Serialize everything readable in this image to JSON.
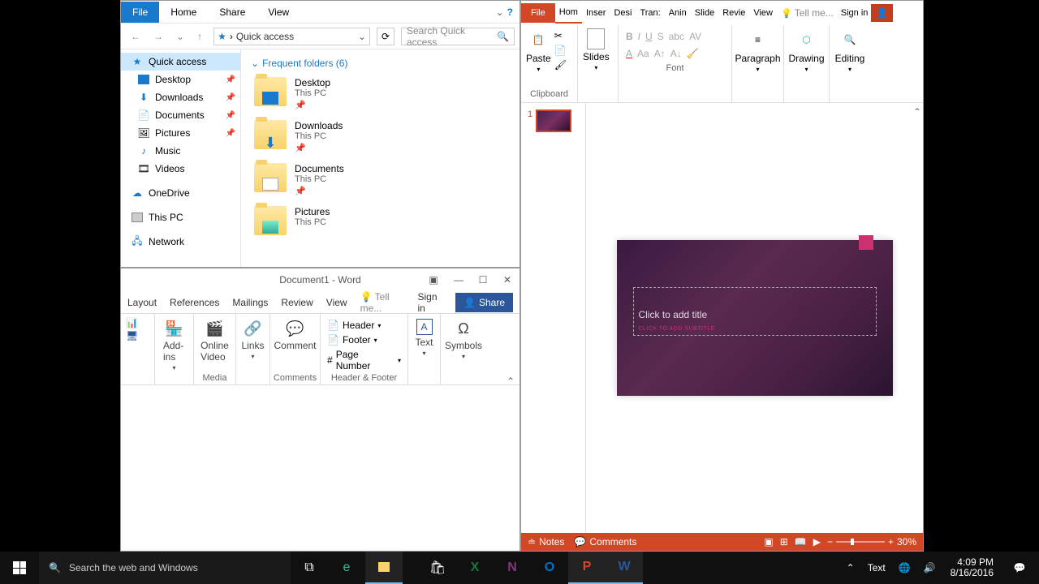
{
  "explorer": {
    "tabs": {
      "file": "File",
      "home": "Home",
      "share": "Share",
      "view": "View"
    },
    "address": {
      "root": "Quick access"
    },
    "search_placeholder": "Search Quick access",
    "sidebar": {
      "quick_access": "Quick access",
      "desktop": "Desktop",
      "downloads": "Downloads",
      "documents": "Documents",
      "pictures": "Pictures",
      "music": "Music",
      "videos": "Videos",
      "onedrive": "OneDrive",
      "thispc": "This PC",
      "network": "Network"
    },
    "content_header": "Frequent folders (6)",
    "folders": [
      {
        "name": "Desktop",
        "sub": "This PC"
      },
      {
        "name": "Downloads",
        "sub": "This PC"
      },
      {
        "name": "Documents",
        "sub": "This PC"
      },
      {
        "name": "Pictures",
        "sub": "This PC"
      }
    ]
  },
  "word": {
    "title": "Document1 - Word",
    "tabs": {
      "layout": "Layout",
      "references": "References",
      "mailings": "Mailings",
      "review": "Review",
      "view": "View",
      "tell": "Tell me...",
      "signin": "Sign in",
      "share": "Share"
    },
    "ribbon": {
      "addins": "Add-ins",
      "online_video": "Online Video",
      "links": "Links",
      "comment": "Comment",
      "header": "Header",
      "footer": "Footer",
      "page_number": "Page Number",
      "text": "Text",
      "symbols": "Symbols",
      "groups": {
        "media": "Media",
        "comments": "Comments",
        "headerfooter": "Header & Footer"
      }
    }
  },
  "ppt": {
    "tabs": {
      "file": "File",
      "home": "Hom",
      "insert": "Inser",
      "design": "Desi",
      "transitions": "Tran:",
      "animations": "Anin",
      "slideshow": "Slide",
      "review": "Revie",
      "view": "View",
      "tell": "Tell me...",
      "signin": "Sign in"
    },
    "ribbon": {
      "paste": "Paste",
      "slides": "Slides",
      "paragraph": "Paragraph",
      "drawing": "Drawing",
      "editing": "Editing",
      "groups": {
        "clipboard": "Clipboard",
        "font": "Font"
      }
    },
    "slide": {
      "num": "1",
      "title": "Click to add title",
      "subtitle": "CLICK TO ADD SUBTITLE"
    },
    "status": {
      "notes": "Notes",
      "comments": "Comments",
      "zoom": "30%"
    }
  },
  "taskbar": {
    "search": "Search the web and Windows",
    "clock": {
      "time": "4:09 PM",
      "date": "8/16/2016"
    },
    "text_indicator": "Text"
  }
}
